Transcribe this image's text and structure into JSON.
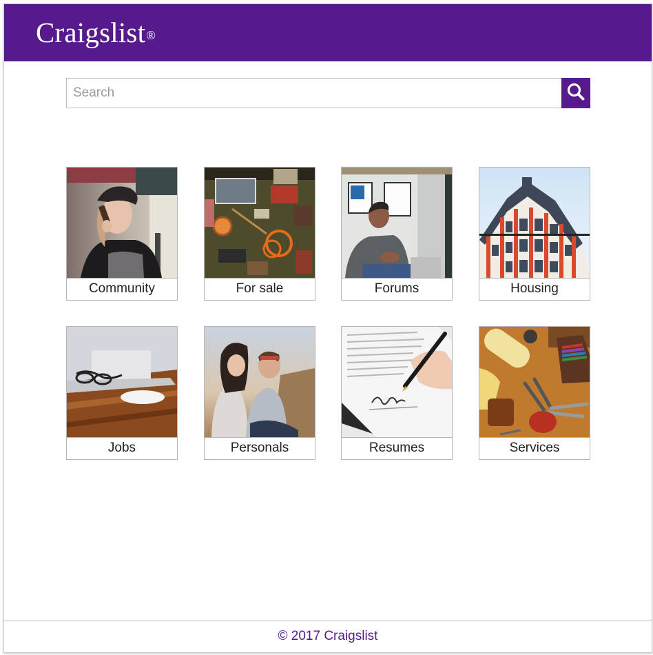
{
  "app": {
    "title": "Craigslist",
    "trademark": "®",
    "accent": "#561a8d"
  },
  "search": {
    "placeholder": "Search",
    "value": "",
    "icon": "search-icon"
  },
  "categories": [
    {
      "label": "Community",
      "image": "woman-on-phone-photo"
    },
    {
      "label": "For sale",
      "image": "flea-market-items-photo"
    },
    {
      "label": "Forums",
      "image": "man-talking-photo"
    },
    {
      "label": "Housing",
      "image": "apartment-building-photo"
    },
    {
      "label": "Jobs",
      "image": "laptop-desk-photo"
    },
    {
      "label": "Personals",
      "image": "couple-laughing-photo"
    },
    {
      "label": "Resumes",
      "image": "signing-document-photo"
    },
    {
      "label": "Services",
      "image": "tools-photo"
    }
  ],
  "footer": {
    "text": "© 2017 Craigslist"
  }
}
